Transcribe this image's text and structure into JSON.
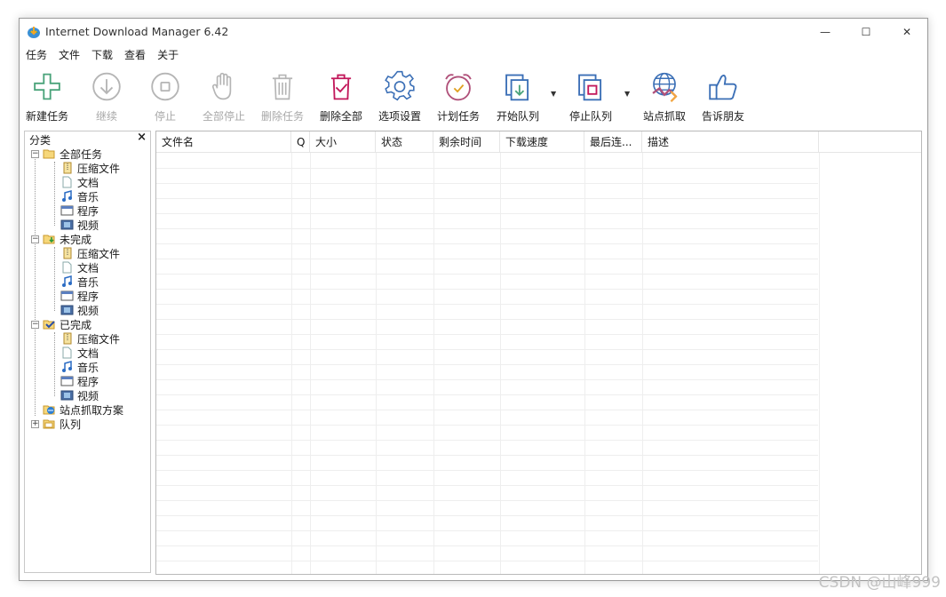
{
  "window": {
    "title": "Internet Download Manager 6.42",
    "controls": {
      "minimize": "—",
      "maximize": "☐",
      "close": "✕"
    }
  },
  "menu": [
    "任务",
    "文件",
    "下载",
    "查看",
    "关于"
  ],
  "toolbar": [
    {
      "id": "new-task",
      "label": "新建任务",
      "icon": "plus-icon",
      "enabled": true
    },
    {
      "id": "resume",
      "label": "继续",
      "icon": "download-arrow-icon",
      "enabled": false
    },
    {
      "id": "stop",
      "label": "停止",
      "icon": "stop-icon",
      "enabled": false
    },
    {
      "id": "stop-all",
      "label": "全部停止",
      "icon": "hand-icon",
      "enabled": false
    },
    {
      "id": "delete-task",
      "label": "删除任务",
      "icon": "trash-icon",
      "enabled": false
    },
    {
      "id": "delete-all",
      "label": "删除全部",
      "icon": "trash-check-icon",
      "enabled": true
    },
    {
      "id": "options",
      "label": "选项设置",
      "icon": "gear-icon",
      "enabled": true
    },
    {
      "id": "scheduler",
      "label": "计划任务",
      "icon": "alarm-clock-icon",
      "enabled": true
    },
    {
      "id": "start-queue",
      "label": "开始队列",
      "icon": "start-queue-icon",
      "enabled": true,
      "dropdown": true
    },
    {
      "id": "stop-queue",
      "label": "停止队列",
      "icon": "stop-queue-icon",
      "enabled": true,
      "dropdown": true
    },
    {
      "id": "site-grabber",
      "label": "站点抓取",
      "icon": "globe-icon",
      "enabled": true
    },
    {
      "id": "tell-friend",
      "label": "告诉朋友",
      "icon": "thumbs-up-icon",
      "enabled": true
    }
  ],
  "sidebar": {
    "title": "分类",
    "close": "×",
    "groups": [
      {
        "label": "全部任务",
        "icon": "folder-open-icon",
        "children": [
          "压缩文件",
          "文档",
          "音乐",
          "程序",
          "视频"
        ]
      },
      {
        "label": "未完成",
        "icon": "folder-download-icon",
        "children": [
          "压缩文件",
          "文档",
          "音乐",
          "程序",
          "视频"
        ]
      },
      {
        "label": "已完成",
        "icon": "folder-check-icon",
        "children": [
          "压缩文件",
          "文档",
          "音乐",
          "程序",
          "视频"
        ]
      }
    ],
    "site_grabber": "站点抓取方案",
    "queue": "队列"
  },
  "columns": [
    "文件名",
    "Q",
    "大小",
    "状态",
    "剩余时间",
    "下载速度",
    "最后连...",
    "描述"
  ],
  "watermark": "CSDN @山峰999"
}
